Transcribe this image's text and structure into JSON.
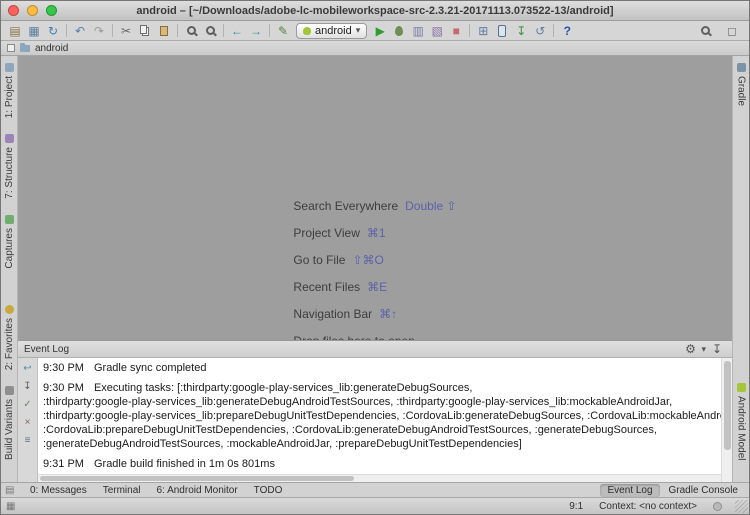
{
  "window": {
    "title": "android – [~/Downloads/adobe-lc-mobileworkspace-src-2.3.21-20171113.073522-13/android]"
  },
  "colors": {
    "android_green": "#a4c639",
    "run_green": "#2f9e2f",
    "stop_red": "#c96a6a",
    "editor_background": "#9e9e9e",
    "shortcut_key_blue": "#5b62a9"
  },
  "toolbar": {
    "run_config": "android",
    "icons": [
      "open",
      "save-all",
      "sync",
      "undo",
      "redo",
      "cut",
      "copy",
      "paste",
      "find",
      "replace",
      "back",
      "forward",
      "edit-configurations",
      "run",
      "debug",
      "run-with-coverage",
      "profiler",
      "stop",
      "project-structure",
      "avd-manager",
      "sdk-manager",
      "gradle-sync",
      "help",
      "search-everywhere",
      "maximize"
    ]
  },
  "navbar": {
    "breadcrumb": "android"
  },
  "left_stripe": {
    "top": [
      {
        "label": "1: Project",
        "icon": "project"
      },
      {
        "label": "7: Structure",
        "icon": "structure"
      },
      {
        "label": "Captures",
        "icon": "captures"
      }
    ],
    "bottom": [
      {
        "label": "2: Favorites",
        "icon": "favorites"
      },
      {
        "label": "Build Variants",
        "icon": "build-variants"
      }
    ]
  },
  "right_stripe": {
    "top": [
      {
        "label": "Gradle",
        "icon": "gradle"
      }
    ],
    "bottom": [
      {
        "label": "Android Model",
        "icon": "android-model"
      }
    ]
  },
  "editor": {
    "shortcuts": [
      {
        "label": "Search Everywhere",
        "keys": "Double ⇧"
      },
      {
        "label": "Project View",
        "keys": "⌘1"
      },
      {
        "label": "Go to File",
        "keys": "⇧⌘O"
      },
      {
        "label": "Recent Files",
        "keys": "⌘E"
      },
      {
        "label": "Navigation Bar",
        "keys": "⌘↑"
      },
      {
        "label": "Drop files here to open",
        "keys": ""
      }
    ]
  },
  "event_log": {
    "title": "Event Log",
    "header_icons": [
      "settings",
      "hide"
    ],
    "toolbar_icons": [
      "soft-wrap",
      "scroll-to-end",
      "mark-all-read",
      "clear-all",
      "filter"
    ],
    "lines": [
      {
        "time": "9:30 PM",
        "text": "Gradle sync completed",
        "first": "true"
      },
      {
        "time": "9:30 PM",
        "text": "Executing tasks: [:thirdparty:google-play-services_lib:generateDebugSources,",
        "first": "true"
      },
      {
        "time": "",
        "text": ":thirdparty:google-play-services_lib:generateDebugAndroidTestSources, :thirdparty:google-play-services_lib:mockableAndroidJar,",
        "first": "false"
      },
      {
        "time": "",
        "text": ":thirdparty:google-play-services_lib:prepareDebugUnitTestDependencies, :CordovaLib:generateDebugSources, :CordovaLib:mockableAndroidJa",
        "first": "false"
      },
      {
        "time": "",
        "text": ":CordovaLib:prepareDebugUnitTestDependencies, :CordovaLib:generateDebugAndroidTestSources, :generateDebugSources,",
        "first": "false"
      },
      {
        "time": "",
        "text": ":generateDebugAndroidTestSources, :mockableAndroidJar, :prepareDebugUnitTestDependencies]",
        "first": "false"
      },
      {
        "time": "9:31 PM",
        "text": "Gradle build finished in 1m 0s 801ms",
        "first": "true"
      }
    ]
  },
  "tool_window_bar": {
    "left": [
      {
        "label": "0: Messages"
      },
      {
        "label": "Terminal"
      },
      {
        "label": "6: Android Monitor"
      },
      {
        "label": "TODO"
      }
    ],
    "right": [
      {
        "label": "Event Log",
        "active": "true"
      },
      {
        "label": "Gradle Console",
        "active": "false"
      }
    ]
  },
  "status_bar": {
    "caret_position": "9:1",
    "context": "Context: <no context>"
  }
}
